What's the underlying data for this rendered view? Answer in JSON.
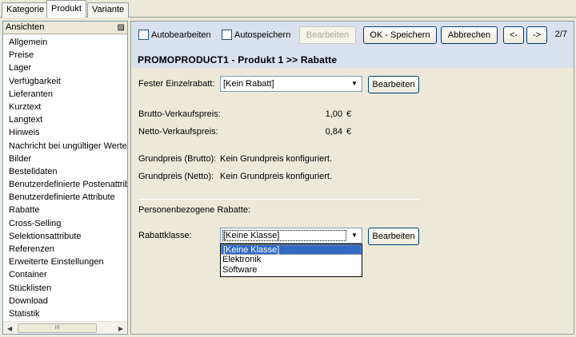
{
  "tabs": [
    "Kategorie",
    "Produkt",
    "Variante"
  ],
  "sidebar": {
    "title": "Ansichten",
    "pin_glyph": "▨",
    "items": [
      "Allgemein",
      "Preise",
      "Lager",
      "Verfügbarkeit",
      "Lieferanten",
      "Kurztext",
      "Langtext",
      "Hinweis",
      "Nachricht bei ungültiger Werteko",
      "Bilder",
      "Bestelldaten",
      "Benutzerdefinierte Postenattribu",
      "Benutzerdefinierte Attribute",
      "Rabatte",
      "Cross-Selling",
      "Selektionsattribute",
      "Referenzen",
      "Erweiterte Einstellungen",
      "Container",
      "Stücklisten",
      "Download",
      "Statistik"
    ],
    "scroll_left": "◀",
    "scroll_right": "▶",
    "thumb_grip": "III"
  },
  "toolbar": {
    "autobearbeiten": "Autobearbeiten",
    "autospeichern": "Autospeichern",
    "bearbeiten": "Bearbeiten",
    "ok_speichern": "OK - Speichern",
    "abbrechen": "Abbrechen",
    "prev": "<-",
    "next": "->",
    "page": "2/7"
  },
  "heading": "PROMOPRODUCT1 - Produkt 1 >> Rabatte",
  "form": {
    "fester_label": "Fester Einzelrabatt:",
    "fester_value": "[Kein Rabatt]",
    "fester_button": "Bearbeiten",
    "brutto_label": "Brutto-Verkaufspreis:",
    "brutto_value": "1,00",
    "netto_label": "Netto-Verkaufspreis:",
    "netto_value": "0,84",
    "currency": "€",
    "grund_brutto_label": "Grundpreis (Brutto):",
    "grund_brutto_value": "Kein Grundpreis konfiguriert.",
    "grund_netto_label": "Grundpreis (Netto):",
    "grund_netto_value": "Kein Grundpreis konfiguriert.",
    "personen_label": "Personenbezogene Rabatte:",
    "klasse_label": "Rabattklasse:",
    "klasse_value": "[Keine Klasse]",
    "klasse_button": "Bearbeiten",
    "dropdown_arrow": "▼",
    "klasse_options": [
      "[Keine Klasse]",
      "Elektronik",
      "Software"
    ]
  }
}
